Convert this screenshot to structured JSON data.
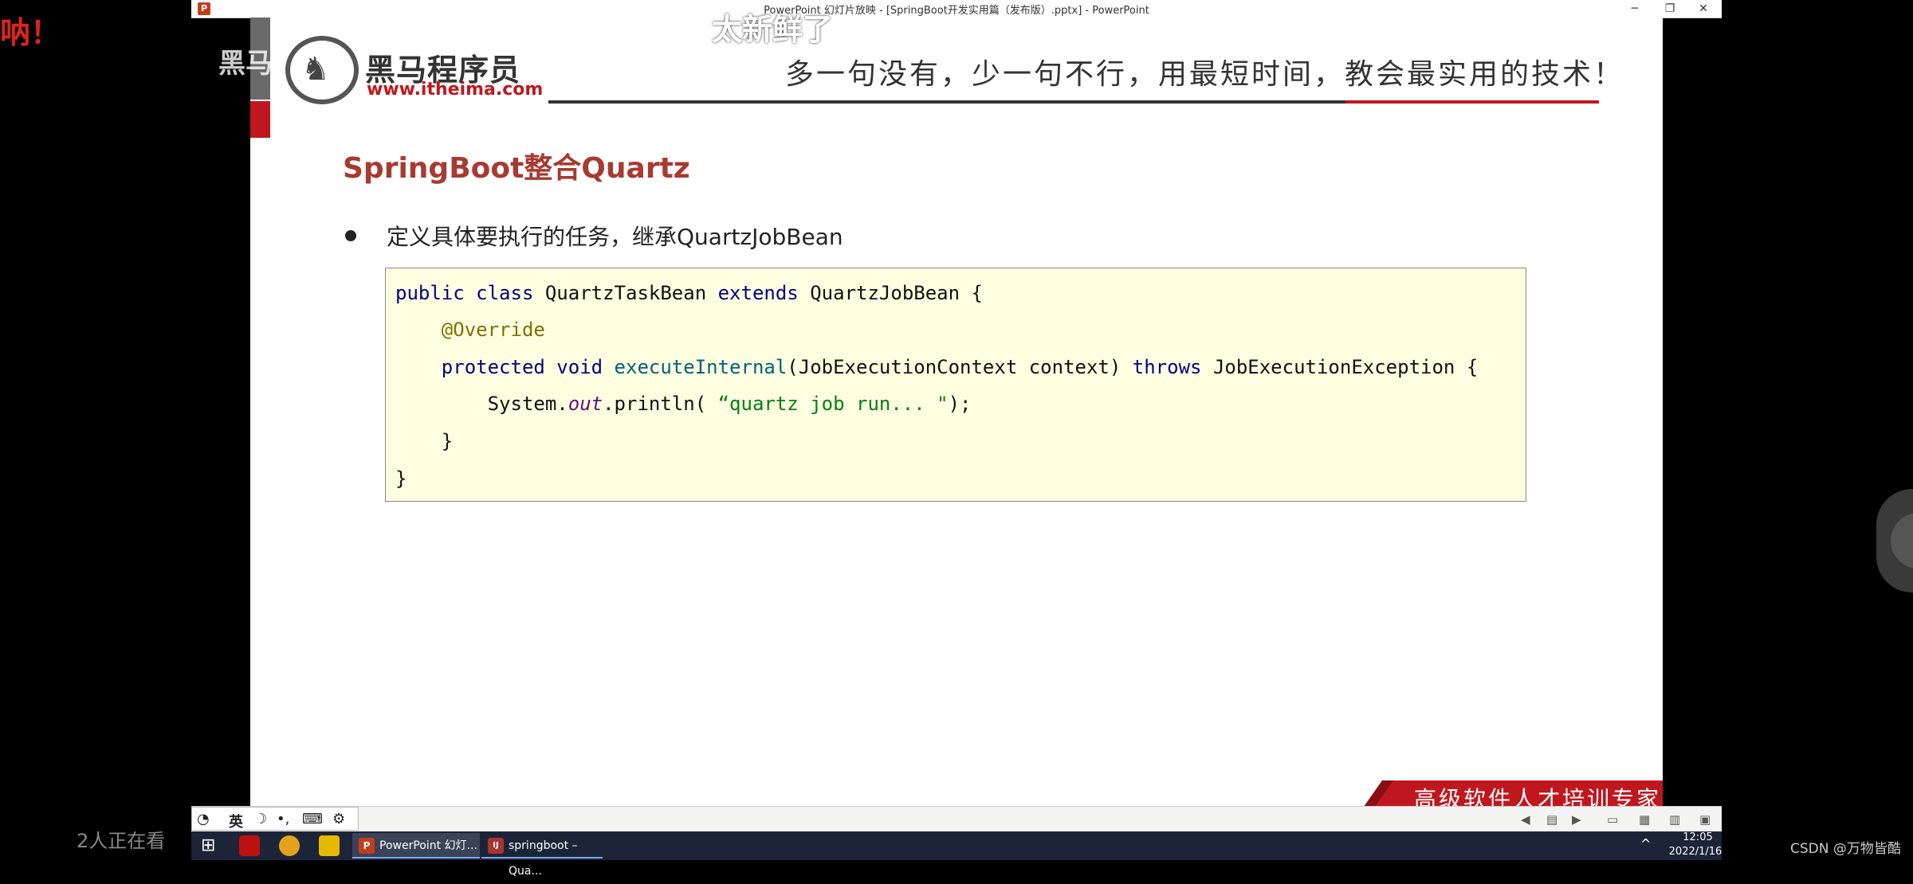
{
  "window": {
    "title": "PowerPoint 幻灯片放映 - [SpringBoot开发实用篇（发布版）.pptx] - PowerPoint",
    "app_icon": "P",
    "controls": {
      "minimize": "─",
      "restore": "❐",
      "close": "✕"
    }
  },
  "slide": {
    "logo": {
      "name_cn": "黑马程序员",
      "url": "www.itheima.com"
    },
    "slogan": "多一句没有，少一句不行，用最短时间，教会最实用的技术！",
    "title": "SpringBoot整合Quartz",
    "bullet": "定义具体要执行的任务，继承QuartzJobBean",
    "code": {
      "line1": {
        "kw1": "public",
        "kw2": "class",
        "name": "QuartzTaskBean",
        "kw3": "extends",
        "parent": "QuartzJobBean {"
      },
      "line2": {
        "annotation": "@Override"
      },
      "line3": {
        "kw1": "protected",
        "kw2": "void",
        "method": "executeInternal",
        "params": "(JobExecutionContext context)",
        "kw3": "throws",
        "exception": "JobExecutionException {"
      },
      "line4": {
        "obj": "System.",
        "field": "out",
        "call": ".println( ",
        "string": "“quartz job run... \"",
        "end": ");"
      },
      "line5": "}",
      "line6": "}"
    },
    "footer": "高级软件人才培训专家"
  },
  "overlays": {
    "top_danmaku": "太新鲜了",
    "left_red": "呐！",
    "left_white": "黑马"
  },
  "ime_bar": {
    "mode": "英",
    "moon": "☽",
    "punct": "•,",
    "keyboard": "⌨",
    "settings": "⚙"
  },
  "taskbar": {
    "tasks": [
      {
        "icon": "P",
        "label": "PowerPoint 幻灯..."
      },
      {
        "icon": "IJ",
        "label": "springboot – Qua..."
      }
    ],
    "tray_caret": "^",
    "time": "12:05",
    "date": "2022/1/16"
  },
  "live": {
    "viewers": "2人正在看"
  },
  "watermark": "CSDN @万物皆酷",
  "colors": {
    "accent_red": "#c0171e",
    "title_red": "#a73a31",
    "code_bg": "#fefee0",
    "taskbar": "#1c2438"
  }
}
